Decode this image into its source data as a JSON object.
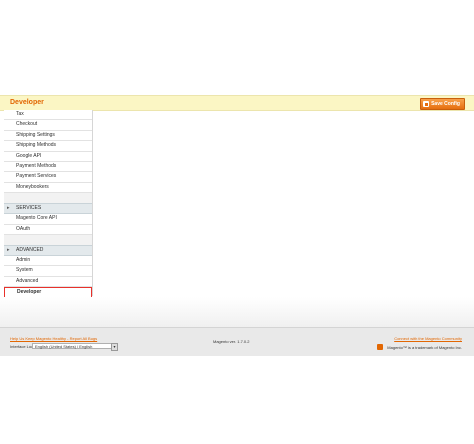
{
  "header": {
    "title": "Developer",
    "save_label": "Save Config"
  },
  "sidebar": {
    "sales_items": [
      "Tax",
      "Checkout",
      "Shipping Settings",
      "Shipping Methods",
      "Google API",
      "Payment Methods",
      "Payment Services",
      "Moneybookers"
    ],
    "services_section": "SERVICES",
    "services_items": [
      "Magento Core API",
      "OAuth"
    ],
    "advanced_section": "ADVANCED",
    "advanced_items": [
      "Admin",
      "System",
      "Advanced"
    ],
    "active_item": "Developer",
    "section_marker": "▸"
  },
  "footer": {
    "help_link": "Help Us Keep Magento Healthy - Report All Bugs",
    "locale_label": "Interface Locale:",
    "locale_value": "English (United States) / English",
    "locale_arrow": "▾",
    "version": "Magento ver. 1.7.0.2",
    "community_link": "Connect with the Magento Community",
    "trademark": "Magento™ is a trademark of Magento Inc."
  }
}
